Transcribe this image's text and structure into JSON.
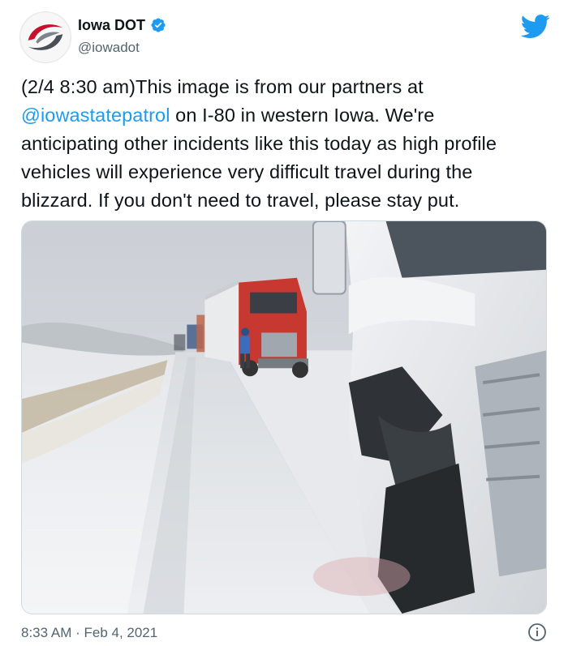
{
  "account": {
    "display_name": "Iowa DOT",
    "handle": "@iowadot",
    "verified": true,
    "avatar_icon": "iowa-dot-logo-icon"
  },
  "tweet": {
    "lines": [
      [
        {
          "text": "(2/4 8:30 am)This image is from our partners at",
          "mention": false
        }
      ],
      [
        {
          "text": "@iowastatepatrol",
          "mention": true
        },
        {
          "text": " on I-80 in western Iowa. We're",
          "mention": false
        }
      ],
      [
        {
          "text": "anticipating other incidents like this today as high profile",
          "mention": false
        }
      ],
      [
        {
          "text": "vehicles will experience very difficult travel during the",
          "mention": false
        }
      ],
      [
        {
          "text": "blizzard. If you don't need to travel, please stay put.",
          "mention": false
        }
      ]
    ]
  },
  "media": {
    "description_icon": "photo-icon"
  },
  "footer": {
    "timestamp": "8:33 AM · Feb 4, 2021",
    "info_icon": "info-icon"
  },
  "colors": {
    "link": "#1d9bf0",
    "twitter_blue": "#1d9bf0",
    "secondary_text": "#536471",
    "primary_text": "#0f1419"
  }
}
